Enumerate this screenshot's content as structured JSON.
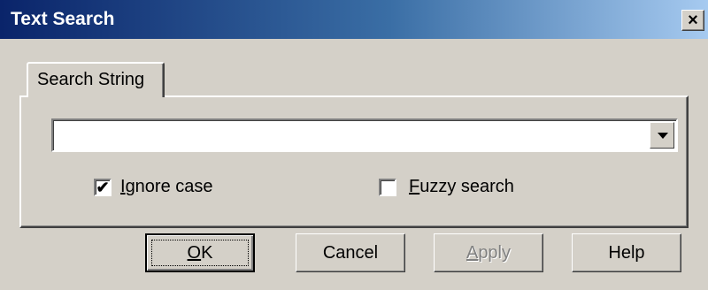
{
  "window": {
    "title": "Text Search",
    "close_symbol": "×"
  },
  "tab": {
    "label": "Search String"
  },
  "search": {
    "value": "",
    "placeholder": ""
  },
  "options": {
    "ignore_case": {
      "mnemonic": "I",
      "rest": "gnore case",
      "checked": true,
      "mark": "✔"
    },
    "fuzzy_search": {
      "mnemonic": "F",
      "rest": "uzzy search",
      "checked": false,
      "mark": ""
    }
  },
  "buttons": {
    "ok": {
      "mnemonic": "O",
      "rest": "K"
    },
    "cancel": "Cancel",
    "apply": {
      "mnemonic": "A",
      "rest": "pply"
    },
    "help": "Help"
  }
}
